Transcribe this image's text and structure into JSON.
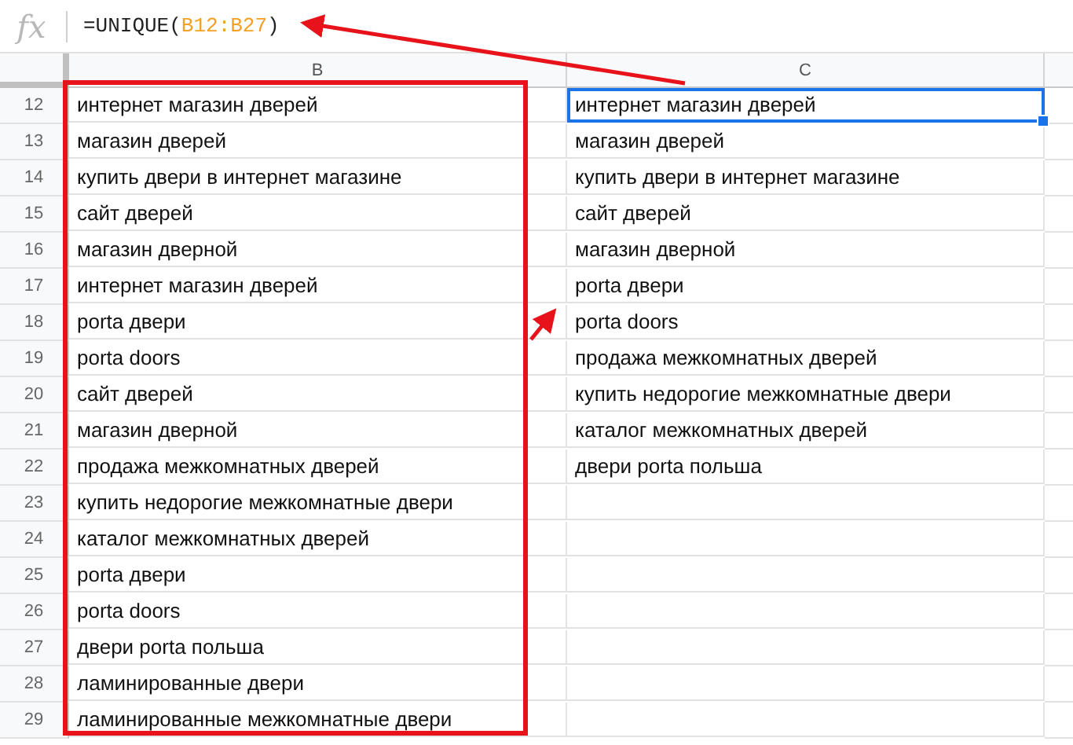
{
  "formula_bar": {
    "icon": "fx",
    "formula_prefix": "=UNIQUE(",
    "formula_range": "B12:B27",
    "formula_suffix": ")"
  },
  "columns": [
    {
      "label": "B",
      "selected": false
    },
    {
      "label": "C",
      "selected": false
    }
  ],
  "rows": [
    {
      "number": "12",
      "cells": [
        {
          "text": "интернет магазин дверей",
          "selected": false
        },
        {
          "text": "интернет магазин дверей",
          "selected": true
        }
      ]
    },
    {
      "number": "13",
      "cells": [
        {
          "text": "магазин дверей",
          "selected": false
        },
        {
          "text": "магазин дверей",
          "selected": false
        }
      ]
    },
    {
      "number": "14",
      "cells": [
        {
          "text": "купить двери в интернет магазине",
          "selected": false
        },
        {
          "text": "купить двери в интернет магазине",
          "selected": false
        }
      ]
    },
    {
      "number": "15",
      "cells": [
        {
          "text": "сайт дверей",
          "selected": false
        },
        {
          "text": "сайт дверей",
          "selected": false
        }
      ]
    },
    {
      "number": "16",
      "cells": [
        {
          "text": "магазин дверной",
          "selected": false
        },
        {
          "text": "магазин дверной",
          "selected": false
        }
      ]
    },
    {
      "number": "17",
      "cells": [
        {
          "text": "интернет магазин дверей",
          "selected": false
        },
        {
          "text": "porta двери",
          "selected": false
        }
      ]
    },
    {
      "number": "18",
      "cells": [
        {
          "text": "porta двери",
          "selected": false
        },
        {
          "text": "porta doors",
          "selected": false
        }
      ]
    },
    {
      "number": "19",
      "cells": [
        {
          "text": "porta doors",
          "selected": false
        },
        {
          "text": "продажа межкомнатных дверей",
          "selected": false
        }
      ]
    },
    {
      "number": "20",
      "cells": [
        {
          "text": "сайт дверей",
          "selected": false
        },
        {
          "text": "купить недорогие межкомнатные двери",
          "selected": false
        }
      ]
    },
    {
      "number": "21",
      "cells": [
        {
          "text": "магазин дверной",
          "selected": false
        },
        {
          "text": "каталог межкомнатных дверей",
          "selected": false
        }
      ]
    },
    {
      "number": "22",
      "cells": [
        {
          "text": "продажа межкомнатных дверей",
          "selected": false
        },
        {
          "text": "двери porta польша",
          "selected": false
        }
      ]
    },
    {
      "number": "23",
      "cells": [
        {
          "text": "купить недорогие межкомнатные двери",
          "selected": false
        },
        {
          "text": "",
          "selected": false
        }
      ]
    },
    {
      "number": "24",
      "cells": [
        {
          "text": "каталог межкомнатных дверей",
          "selected": false
        },
        {
          "text": "",
          "selected": false
        }
      ]
    },
    {
      "number": "25",
      "cells": [
        {
          "text": "porta двери",
          "selected": false
        },
        {
          "text": "",
          "selected": false
        }
      ]
    },
    {
      "number": "26",
      "cells": [
        {
          "text": "porta doors",
          "selected": false
        },
        {
          "text": "",
          "selected": false
        }
      ]
    },
    {
      "number": "27",
      "cells": [
        {
          "text": "двери porta польша",
          "selected": false
        },
        {
          "text": "",
          "selected": false
        }
      ]
    },
    {
      "number": "28",
      "cells": [
        {
          "text": "ламинированные двери",
          "selected": false
        },
        {
          "text": "",
          "selected": false
        }
      ]
    },
    {
      "number": "29",
      "cells": [
        {
          "text": "ламинированные межкомнатные двери",
          "selected": false
        },
        {
          "text": "",
          "selected": false
        }
      ]
    }
  ]
}
